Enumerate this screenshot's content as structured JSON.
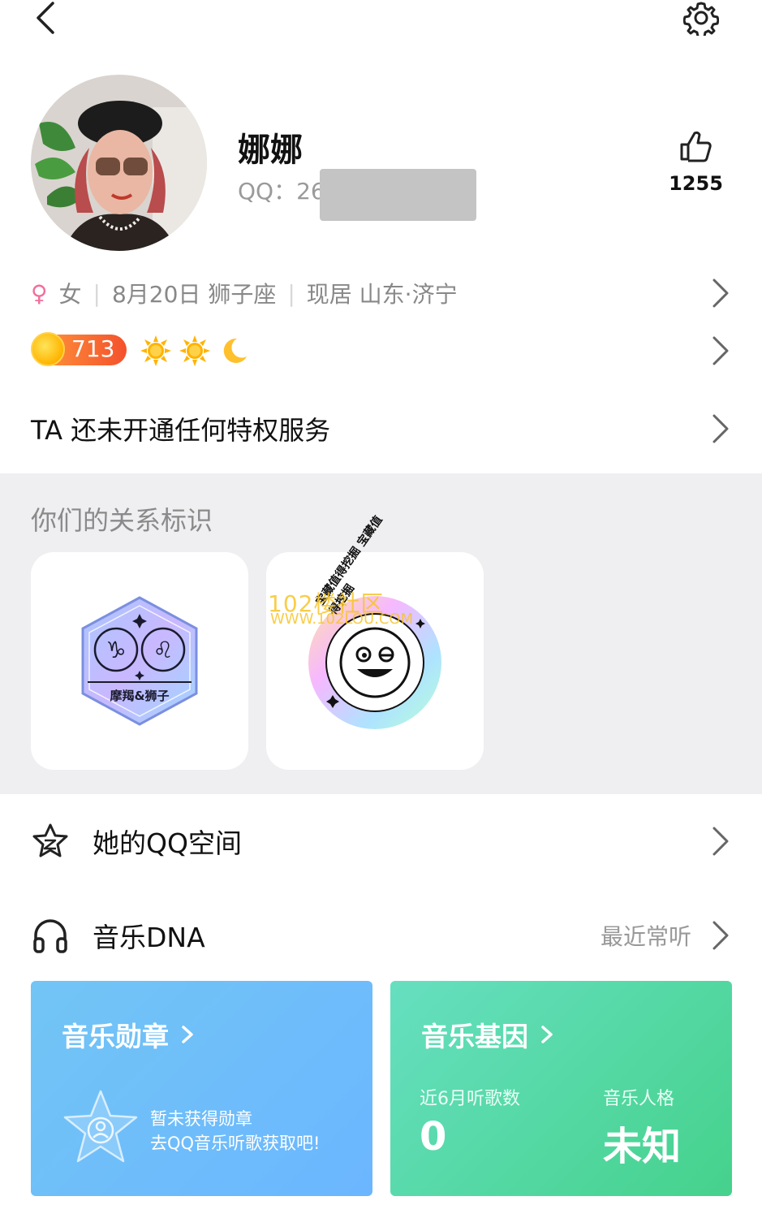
{
  "header": {
    "back_icon": "chevron-left-icon",
    "settings_icon": "gear-icon"
  },
  "profile": {
    "nickname": "娜娜",
    "qq_prefix": "QQ：26",
    "like_count": "1255"
  },
  "info": {
    "gender_symbol": "♀",
    "gender": "女",
    "birthday_sign": "8月20日 狮子座",
    "location": "现居 山东·济宁"
  },
  "level": {
    "value": "713",
    "icons": [
      "sun-icon",
      "sun-icon",
      "moon-icon"
    ]
  },
  "privilege": {
    "text": "TA 还未开通任何特权服务"
  },
  "relation": {
    "title": "你们的关系标识",
    "badge1_label": "摩羯&狮子",
    "badge2_ring_text": "宝藏值得挖掘 宝藏值得挖掘"
  },
  "qzone": {
    "label": "她的QQ空间"
  },
  "music": {
    "label": "音乐DNA",
    "hint": "最近常听",
    "medal_card": {
      "title": "音乐勋章",
      "line1": "暂未获得勋章",
      "line2": "去QQ音乐听歌获取吧!"
    },
    "gene_card": {
      "title": "音乐基因",
      "label1": "近6月听歌数",
      "value1": "0",
      "label2": "音乐人格",
      "value2": "未知"
    }
  },
  "watermark": {
    "line1": "102楼社区",
    "line2": "WWW.102LOU.COM"
  },
  "colors": {
    "gender_pink": "#f26f9c",
    "level_orange": "#f4512c",
    "medal_blue": "#6bb6ff",
    "gene_green": "#45d28c",
    "section_gray": "#efeff2"
  }
}
